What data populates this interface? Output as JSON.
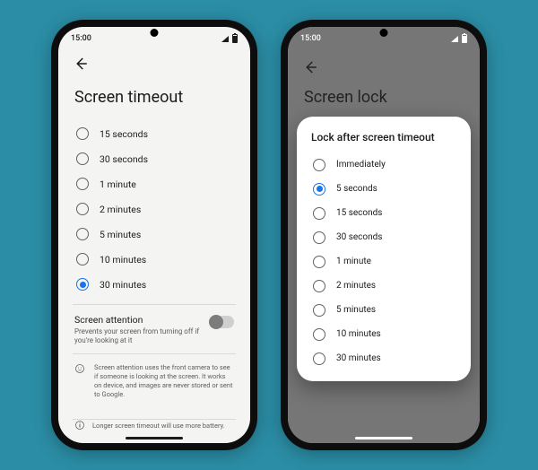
{
  "statusbar": {
    "time": "15:00"
  },
  "left_screen": {
    "page_title": "Screen timeout",
    "options": [
      {
        "label": "15 seconds",
        "selected": false
      },
      {
        "label": "30 seconds",
        "selected": false
      },
      {
        "label": "1 minute",
        "selected": false
      },
      {
        "label": "2 minutes",
        "selected": false
      },
      {
        "label": "5 minutes",
        "selected": false
      },
      {
        "label": "10 minutes",
        "selected": false
      },
      {
        "label": "30 minutes",
        "selected": true
      }
    ],
    "attention": {
      "title": "Screen attention",
      "subtitle": "Prevents your screen from turning off if you're looking at it",
      "enabled": false,
      "info": "Screen attention uses the front camera to see if someone is looking at the screen. It works on device, and images are never stored or sent to Google."
    },
    "footer": "Longer screen timeout will use more battery."
  },
  "right_screen": {
    "page_title": "Screen lock",
    "dialog": {
      "title": "Lock after screen timeout",
      "options": [
        {
          "label": "Immediately",
          "selected": false
        },
        {
          "label": "5 seconds",
          "selected": true
        },
        {
          "label": "15 seconds",
          "selected": false
        },
        {
          "label": "30 seconds",
          "selected": false
        },
        {
          "label": "1 minute",
          "selected": false
        },
        {
          "label": "2 minutes",
          "selected": false
        },
        {
          "label": "5 minutes",
          "selected": false
        },
        {
          "label": "10 minutes",
          "selected": false
        },
        {
          "label": "30 minutes",
          "selected": false
        }
      ]
    }
  }
}
